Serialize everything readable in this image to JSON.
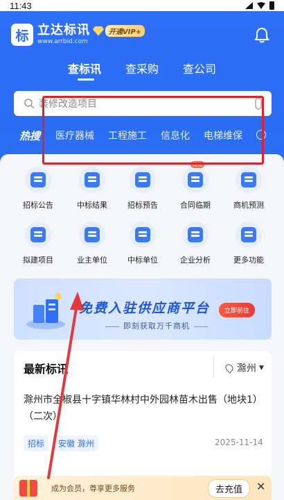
{
  "status": {
    "time": "11:43"
  },
  "app": {
    "name": "立达标讯",
    "domain": "www.arrbid.com",
    "logo_char": "标",
    "vip_label": "开通VIP+"
  },
  "topnav": {
    "tabs": [
      "查标讯",
      "查采购",
      "查公司"
    ],
    "active": 0
  },
  "search": {
    "placeholder": "装修改造项目"
  },
  "hot": {
    "label": "热搜",
    "keywords": [
      "医疗器械",
      "工程施工",
      "信息化",
      "电梯维保"
    ]
  },
  "grid": [
    {
      "label": "招标公告",
      "icon": "bid-notice-icon"
    },
    {
      "label": "中标结果",
      "icon": "award-result-icon"
    },
    {
      "label": "招标预告",
      "icon": "bid-forecast-icon"
    },
    {
      "label": "合同临期",
      "icon": "contract-expiry-icon",
      "badge": "限免"
    },
    {
      "label": "商机预测",
      "icon": "opportunity-forecast-icon"
    },
    {
      "label": "拟建项目",
      "icon": "planned-project-icon"
    },
    {
      "label": "业主单位",
      "icon": "owner-unit-icon"
    },
    {
      "label": "中标单位",
      "icon": "winning-unit-icon"
    },
    {
      "label": "企业分析",
      "icon": "enterprise-analysis-icon"
    },
    {
      "label": "更多功能",
      "icon": "more-functions-icon"
    }
  ],
  "banner": {
    "title": "免费入驻供应商平台",
    "subtitle": "即刻获取万千商机",
    "button": "立即前往"
  },
  "news": {
    "heading": "最新标讯",
    "location": "滁州",
    "item": {
      "title": "滁州市全椒县十字镇华林村中外园林苗木出售（地块1）（二次）",
      "tags": [
        "招标",
        "安徽 滁州"
      ],
      "date": "2025-11-14"
    }
  },
  "promo": {
    "text": "成为会员，尊享更多服务",
    "button": "去充值",
    "close": "✕"
  }
}
